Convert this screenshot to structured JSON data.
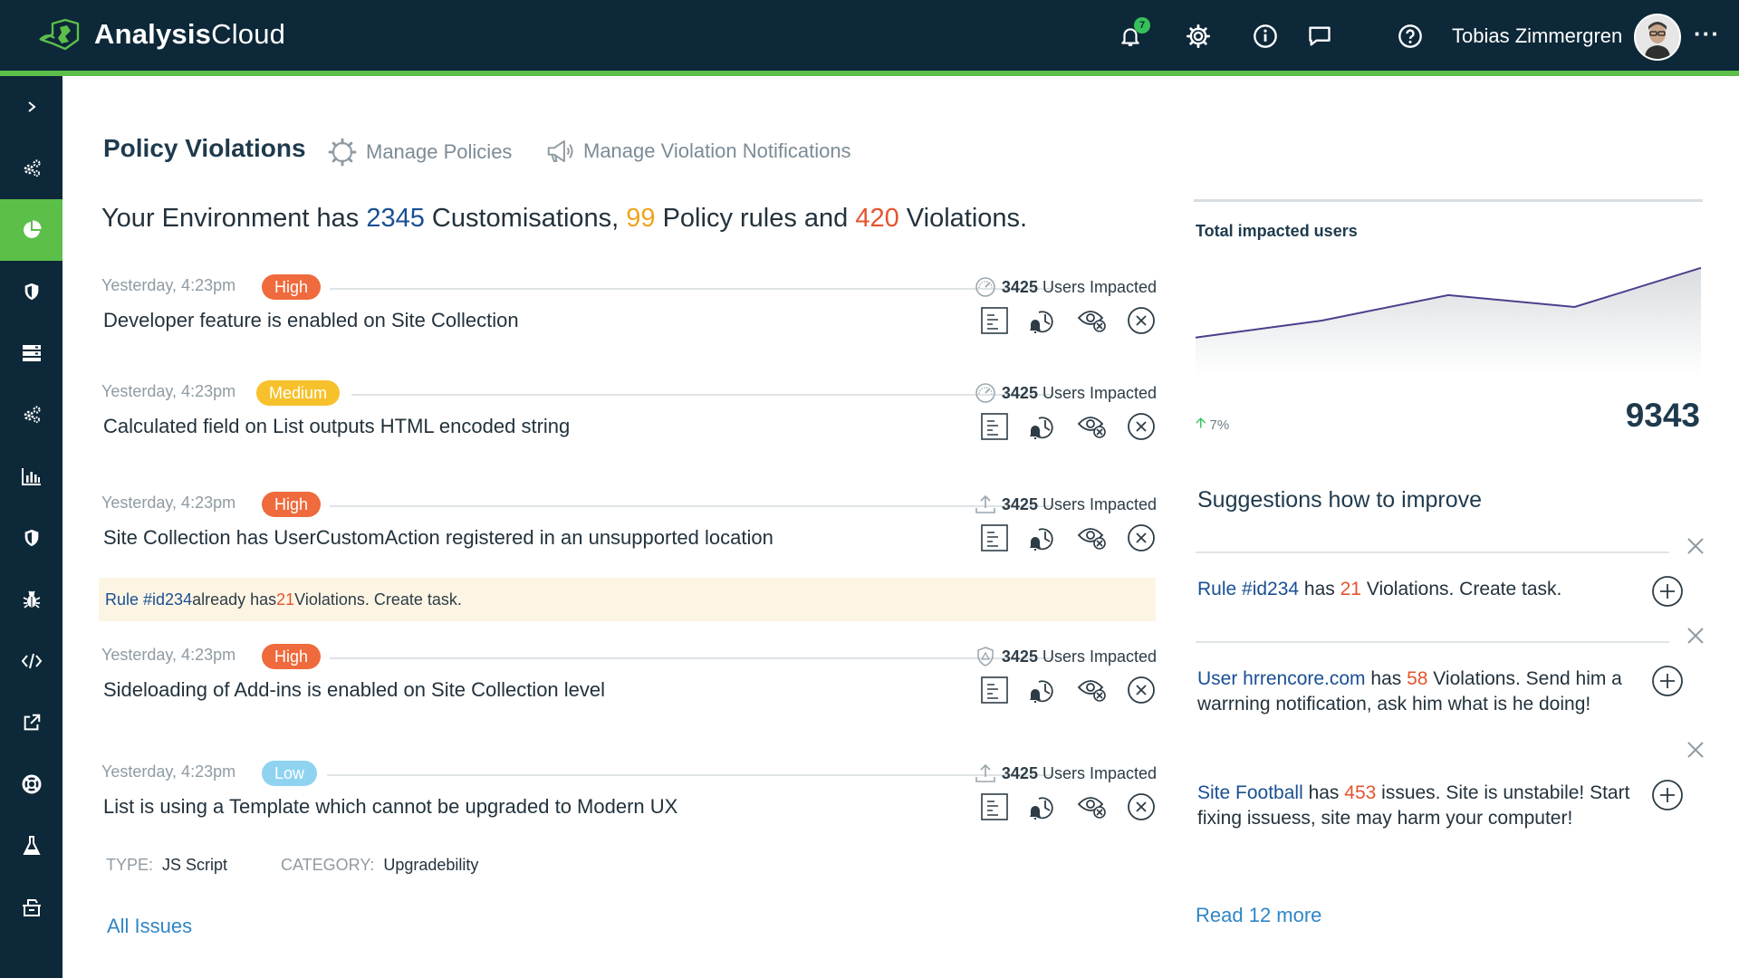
{
  "app": {
    "brand_bold": "Analysis",
    "brand_light": "Cloud"
  },
  "header": {
    "notification_count": "7",
    "user_name": "Tobias Zimmergren",
    "more": "···"
  },
  "page": {
    "title": "Policy Violations",
    "tabs": [
      {
        "label": "Manage Policies",
        "icon": "gear-icon"
      },
      {
        "label": "Manage Violation Notifications",
        "icon": "megaphone-icon"
      }
    ]
  },
  "summary": {
    "prefix": "Your Environment has ",
    "customisations": "2345",
    "mid1": " Customisations, ",
    "policy_rules": "99",
    "mid2": " Policy rules and ",
    "violations": "420",
    "suffix": " Violations."
  },
  "violations": [
    {
      "time": "Yesterday, 4:23pm",
      "severity": "High",
      "users": "3425",
      "impact_label": "Users Impacted",
      "impact_icon": "gauge-icon",
      "title": "Developer feature is enabled on Site Collection"
    },
    {
      "time": "Yesterday, 4:23pm",
      "severity": "Medium",
      "users": "3425",
      "impact_label": "Users Impacted",
      "impact_icon": "gauge-icon",
      "title": "Calculated field on List outputs HTML encoded string"
    },
    {
      "time": "Yesterday, 4:23pm",
      "severity": "High",
      "users": "3425",
      "impact_label": "Users Impacted",
      "impact_icon": "upload-icon",
      "title": "Site Collection has UserCustomAction registered in an unsupported location"
    },
    {
      "time": "Yesterday, 4:23pm",
      "severity": "High",
      "users": "3425",
      "impact_label": "Users Impacted",
      "impact_icon": "shield-icon",
      "title": "Sideloading of Add-ins is enabled on Site Collection level"
    },
    {
      "time": "Yesterday, 4:23pm",
      "severity": "Low",
      "users": "3425",
      "impact_label": "Users Impacted",
      "impact_icon": "upload-icon",
      "title": "List is using a Template which cannot be upgraded to Modern UX"
    }
  ],
  "rule_banner": {
    "rule": "Rule #id234",
    "text1": " already has ",
    "count": "21",
    "text2": " Violations. Create task."
  },
  "details": {
    "type_label": "TYPE:",
    "type_value": "JS Script",
    "category_label": "CATEGORY:",
    "category_value": "Upgradebility"
  },
  "all_issues": "All Issues",
  "impacted_chart": {
    "title": "Total impacted users",
    "trend": "7%",
    "total": "9343"
  },
  "chart_data": {
    "type": "area",
    "title": "Total impacted users",
    "x": [
      0,
      1,
      2,
      3,
      4
    ],
    "values": [
      8650,
      8850,
      9150,
      9010,
      9470
    ],
    "ylim": [
      8200,
      9500
    ],
    "grid": false,
    "legend": "none"
  },
  "suggestions": {
    "title": "Suggestions how to improve",
    "items": [
      {
        "link": "Rule #id234",
        "text1": " has ",
        "count": "21",
        "text2": " Violations. Create task."
      },
      {
        "link": "User hrrencore.com",
        "text1": " has ",
        "count": "58",
        "text2": " Violations. Send him a warrning notification, ask him what is he doing!"
      },
      {
        "link": "Site Football",
        "text1": " has ",
        "count": "453",
        "text2": " issues. Site is unstabile! Start fixing issuess, site may harm your computer!"
      }
    ],
    "read_more": "Read 12 more"
  },
  "colors": {
    "navy": "#0d2838",
    "accent_green": "#5cbf4a",
    "high": "#ef6a3c",
    "medium": "#f6c12b",
    "low": "#8fd3f1",
    "link_blue": "#1a4f94",
    "count_red": "#e5542f",
    "count_orange": "#f2a31e",
    "chart_line": "#4b3f8c"
  },
  "sidebar_icons": [
    "chevron-right-icon",
    "gears-icon",
    "pie-chart-icon",
    "shield-icon",
    "server-icon",
    "gears-icon",
    "bar-chart-icon",
    "shield-icon",
    "bug-icon",
    "code-icon",
    "external-link-icon",
    "lifebuoy-icon",
    "flask-icon",
    "archive-icon"
  ]
}
